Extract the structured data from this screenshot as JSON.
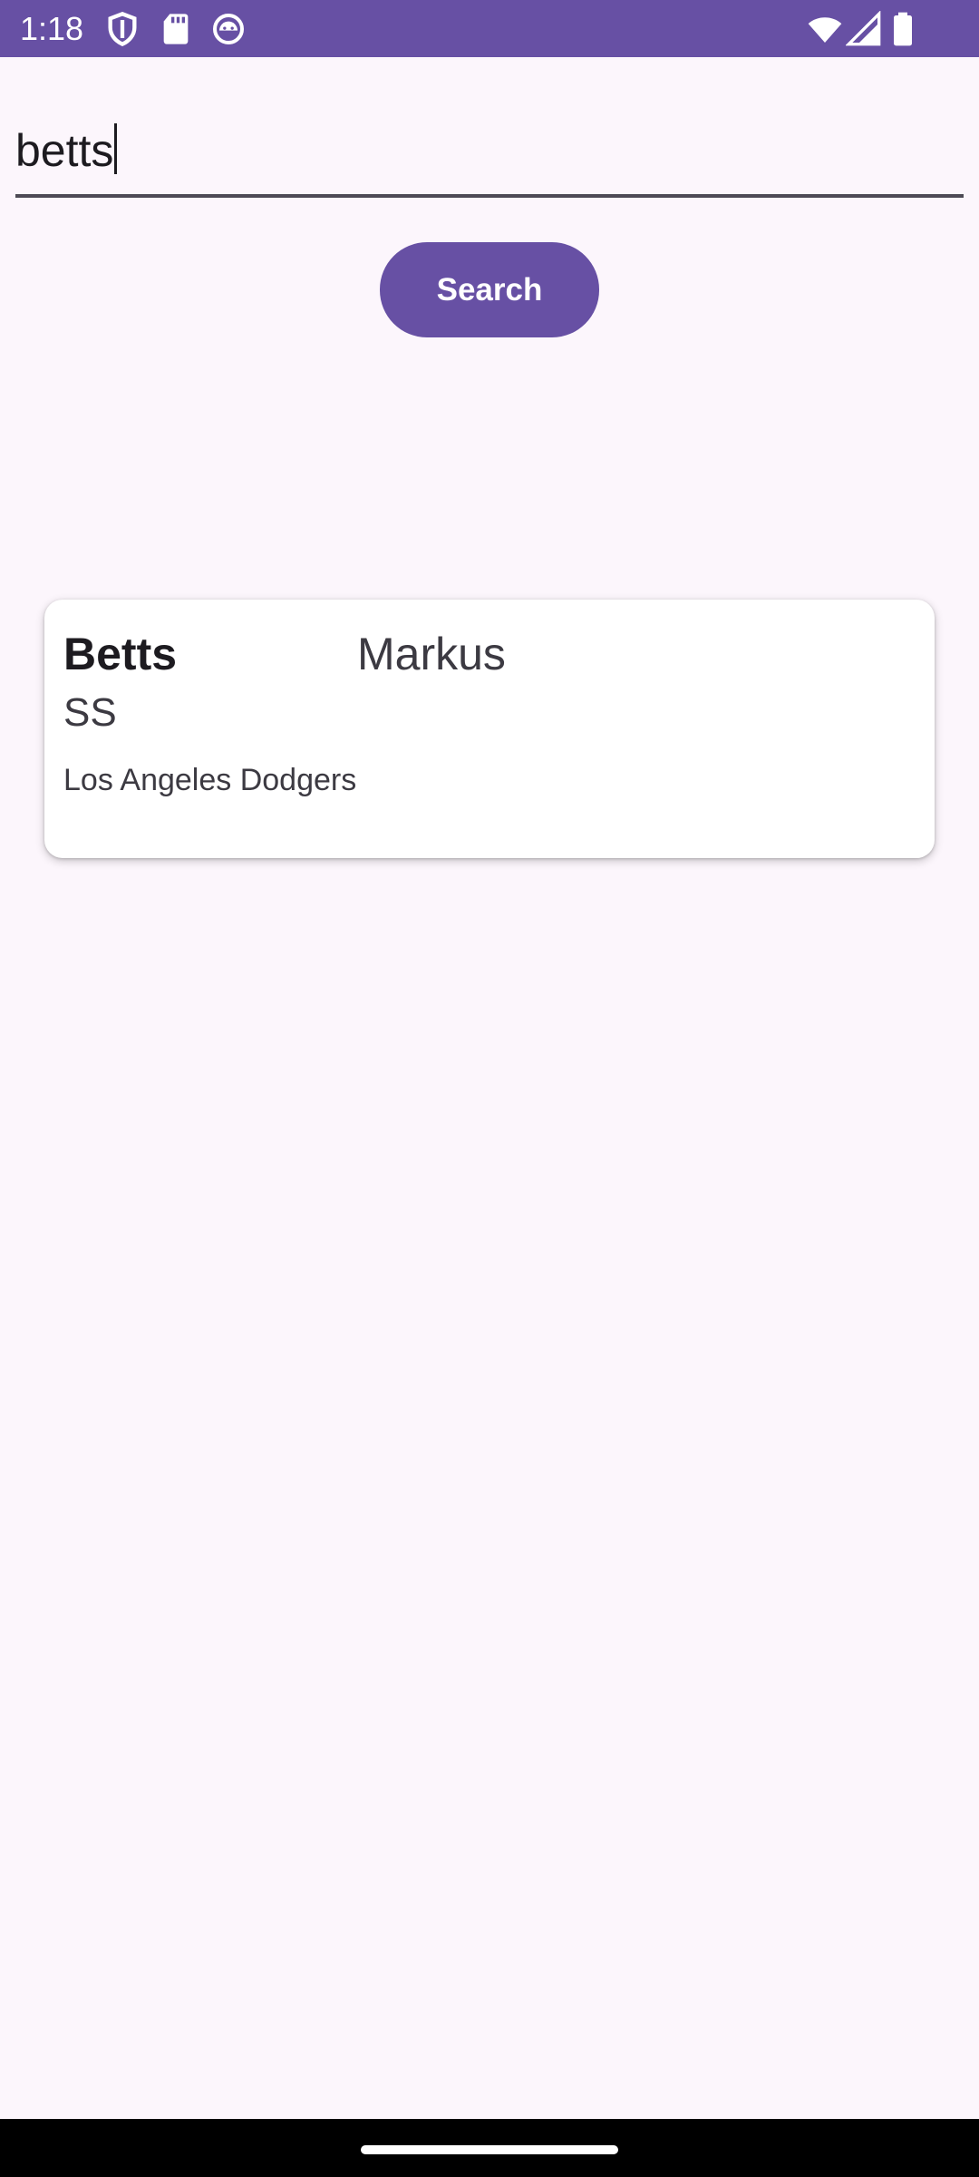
{
  "status_bar": {
    "time": "1:18",
    "background": "#6750a4",
    "icons": [
      "shield-icon",
      "sd-card-icon",
      "android-icon",
      "wifi-icon",
      "signal-icon",
      "battery-icon"
    ]
  },
  "search": {
    "value": "betts",
    "button_label": "Search",
    "accent": "#6750a4"
  },
  "results": [
    {
      "last_name": "Betts",
      "first_name": "Markus",
      "position": "SS",
      "team": "Los Angeles Dodgers"
    }
  ]
}
